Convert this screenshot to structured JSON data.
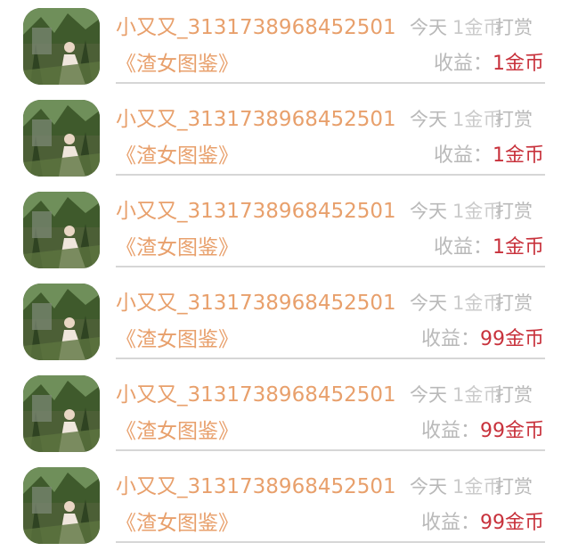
{
  "items": [
    {
      "user": "小又又_3131738968452501",
      "time": "今天",
      "amount_overlay": "1金币",
      "reward_action": "打赏",
      "book": "《渣女图鉴》",
      "earn_label": "收益：",
      "earn_value": "1金币"
    },
    {
      "user": "小又又_3131738968452501",
      "time": "今天",
      "amount_overlay": "1金币",
      "reward_action": "打赏",
      "book": "《渣女图鉴》",
      "earn_label": "收益：",
      "earn_value": "1金币"
    },
    {
      "user": "小又又_3131738968452501",
      "time": "今天",
      "amount_overlay": "1金币",
      "reward_action": "打赏",
      "book": "《渣女图鉴》",
      "earn_label": "收益：",
      "earn_value": "1金币"
    },
    {
      "user": "小又又_3131738968452501",
      "time": "今天",
      "amount_overlay": "1金币",
      "reward_action": "打赏",
      "book": "《渣女图鉴》",
      "earn_label": "收益：",
      "earn_value": "99金币"
    },
    {
      "user": "小又又_3131738968452501",
      "time": "今天",
      "amount_overlay": "1金币",
      "reward_action": "打赏",
      "book": "《渣女图鉴》",
      "earn_label": "收益：",
      "earn_value": "99金币"
    },
    {
      "user": "小又又_3131738968452501",
      "time": "今天",
      "amount_overlay": "1金币",
      "reward_action": "打赏",
      "book": "《渣女图鉴》",
      "earn_label": "收益：",
      "earn_value": "99金币"
    }
  ],
  "colors": {
    "name": "#e8a06c",
    "muted": "#b9b9b9",
    "earn_value": "#c8323c",
    "divider": "#d6d6d6"
  }
}
